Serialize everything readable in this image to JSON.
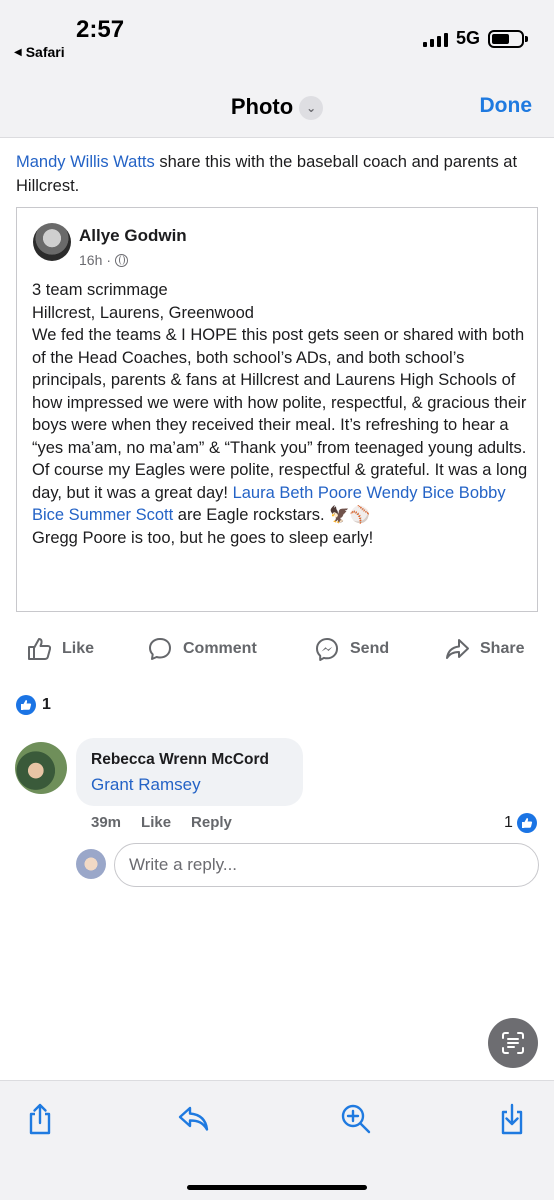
{
  "status_bar": {
    "time": "2:57",
    "back_app": "Safari",
    "network": "5G"
  },
  "nav": {
    "title": "Photo",
    "done_label": "Done"
  },
  "share_message": {
    "mention": "Mandy Willis Watts",
    "text": " share this with the baseball coach and parents at Hillcrest."
  },
  "post": {
    "author": "Allye Godwin",
    "time": "16h",
    "body_lines": [
      "3 team scrimmage",
      "Hillcrest, Laurens, Greenwood",
      "We fed the teams & I HOPE this post gets seen or shared with both of the Head Coaches, both school’s ADs, and both school’s principals, parents & fans at Hillcrest and Laurens High Schools of how impressed we were with how polite, respectful, & gracious their boys were when they received their meal. It’s refreshing to hear a  “yes ma’am, no ma’am” &  “Thank you” from teenaged young adults. Of course my Eagles were polite, respectful & grateful. It was a long day, but it was a great day! "
    ],
    "tag_line_mentions": "Laura Beth Poore Wendy Bice Bobby Bice Summer Scott",
    "tag_line_tail": " are Eagle rockstars. 🦅⚾",
    "last_line": "Gregg Poore is too, but he goes to sleep early!"
  },
  "actions": {
    "like": "Like",
    "comment": "Comment",
    "send": "Send",
    "share": "Share"
  },
  "reactions": {
    "count": "1"
  },
  "comment": {
    "author": "Rebecca Wrenn McCord",
    "text": "Grant Ramsey",
    "time": "39m",
    "like": "Like",
    "reply": "Reply",
    "like_count": "1"
  },
  "reply_box": {
    "placeholder": "Write a reply..."
  },
  "colors": {
    "accent": "#1f7ae0",
    "link": "#2463c6",
    "like_blue": "#1b74e4"
  },
  "icons": {
    "toolbar": [
      "share-icon",
      "reply-arrow-icon",
      "zoom-in-icon",
      "download-icon"
    ],
    "live_text": "live-text-icon"
  }
}
